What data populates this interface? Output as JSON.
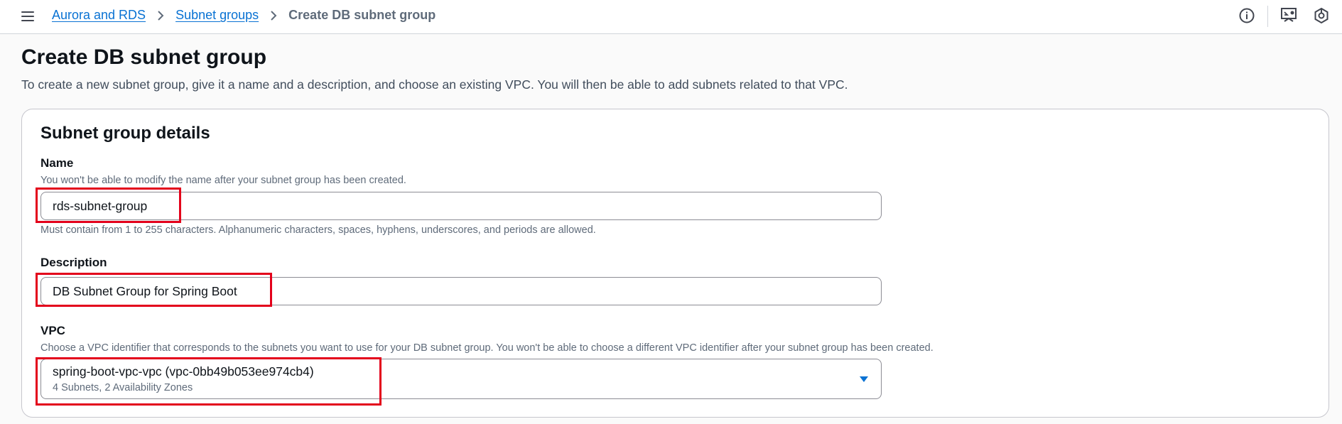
{
  "breadcrumb": {
    "items": [
      "Aurora and RDS",
      "Subnet groups"
    ],
    "current": "Create DB subnet group"
  },
  "header": {
    "title": "Create DB subnet group",
    "description": "To create a new subnet group, give it a name and a description, and choose an existing VPC. You will then be able to add subnets related to that VPC."
  },
  "details": {
    "title": "Subnet group details",
    "name": {
      "label": "Name",
      "hint": "You won't be able to modify the name after your subnet group has been created.",
      "value": "rds-subnet-group",
      "constraint": "Must contain from 1 to 255 characters. Alphanumeric characters, spaces, hyphens, underscores, and periods are allowed."
    },
    "description": {
      "label": "Description",
      "value": "DB Subnet Group for Spring Boot"
    },
    "vpc": {
      "label": "VPC",
      "hint": "Choose a VPC identifier that corresponds to the subnets you want to use for your DB subnet group. You won't be able to choose a different VPC identifier after your subnet group has been created.",
      "selected": "spring-boot-vpc-vpc (vpc-0bb49b053ee974cb4)",
      "selected_detail": "4 Subnets, 2 Availability Zones"
    }
  },
  "colors": {
    "link": "#0972d3",
    "highlight": "#e3001b",
    "caret": "#0972d3"
  },
  "icons": [
    "menu-icon",
    "chevron-right-icon",
    "info-icon",
    "feedback-icon",
    "settings-hexagon-icon",
    "caret-down-icon"
  ]
}
